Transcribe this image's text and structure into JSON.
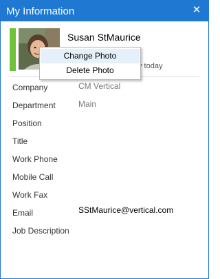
{
  "window": {
    "title": "My Information",
    "close_glyph": "✕",
    "accent_color": "#1f78d1"
  },
  "profile": {
    "name": "Susan StMaurice",
    "status_text": "y today",
    "presence_color": "#6fc23a"
  },
  "photo_menu": {
    "items": [
      {
        "label": "Change Photo"
      },
      {
        "label": "Delete Photo"
      }
    ]
  },
  "fields": [
    {
      "label": "Company",
      "value": "CM Vertical"
    },
    {
      "label": "Department",
      "value": "Main"
    },
    {
      "label": "Position",
      "value": ""
    },
    {
      "label": "Title",
      "value": ""
    },
    {
      "label": "Work Phone",
      "value": ""
    },
    {
      "label": "Mobile Call",
      "value": ""
    },
    {
      "label": "Work Fax",
      "value": ""
    },
    {
      "label": "Email",
      "value": "SStMaurice@vertical.com"
    },
    {
      "label": "Job Description",
      "value": ""
    }
  ]
}
